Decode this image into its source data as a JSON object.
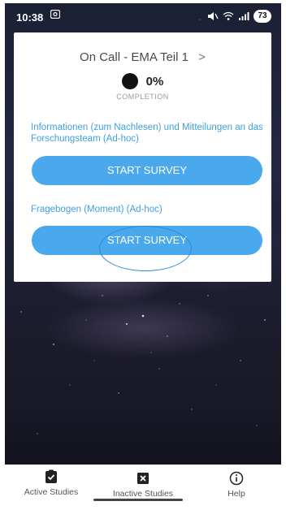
{
  "status_bar": {
    "time": "10:38",
    "battery": "73"
  },
  "study": {
    "title": "On Call - EMA Teil 1",
    "chevron": ">",
    "progress_value": "0%",
    "progress_fraction": 0,
    "completion_label": "COMPLETION"
  },
  "surveys": [
    {
      "description": "Informationen (zum Nachlesen) und Mitteilungen an das Forschungsteam (Ad-hoc)",
      "button_label": "START SURVEY"
    },
    {
      "description": "Fragebogen (Moment) (Ad-hoc)",
      "button_label": "START SURVEY"
    }
  ],
  "bottom_nav": {
    "active": "Active Studies",
    "inactive": "Inactive Studies",
    "help": "Help"
  },
  "colors": {
    "accent": "#4aa9ec",
    "link_text": "#3f9fe0",
    "annotation": "#2f86d8"
  }
}
